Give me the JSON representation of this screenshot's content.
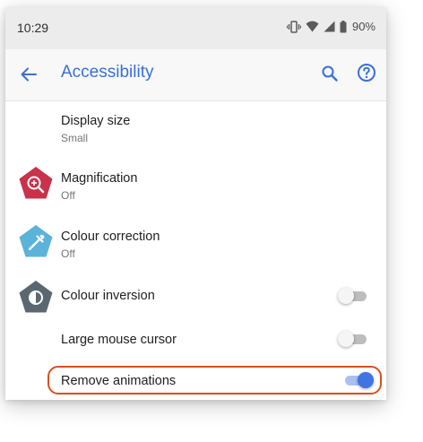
{
  "status_bar": {
    "time": "10:29",
    "battery": "90%",
    "icons": [
      "vibrate-icon",
      "wifi-icon",
      "signal-icon",
      "battery-icon"
    ]
  },
  "app_bar": {
    "title": "Accessibility",
    "back_icon": "back-arrow-icon",
    "search_icon": "search-icon",
    "help_icon": "help-icon",
    "accent_color": "#3a6fd6"
  },
  "settings": [
    {
      "label": "Display size",
      "summary": "Small"
    },
    {
      "label": "Magnification",
      "summary": "Off",
      "icon": "magnification-icon",
      "icon_color": "#c8324b"
    },
    {
      "label": "Colour correction",
      "summary": "Off",
      "icon": "colour-correction-icon",
      "icon_color": "#5bb3da"
    },
    {
      "label": "Colour inversion",
      "icon": "colour-inversion-icon",
      "icon_color": "#5b6770",
      "toggle_state": "off"
    },
    {
      "label": "Large mouse cursor",
      "toggle_state": "off"
    },
    {
      "label": "Remove animations",
      "toggle_state": "on",
      "highlight_color": "#d6501c"
    }
  ]
}
